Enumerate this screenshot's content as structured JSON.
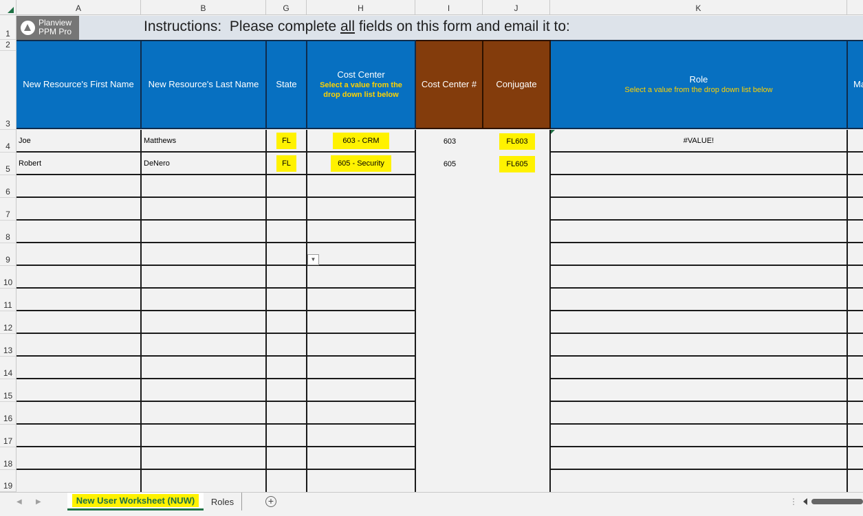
{
  "columns": [
    "A",
    "B",
    "G",
    "H",
    "I",
    "J",
    "K"
  ],
  "rows": [
    "1",
    "2",
    "3",
    "4",
    "5",
    "6",
    "7",
    "8",
    "9",
    "10",
    "11",
    "12",
    "13",
    "14",
    "15",
    "16",
    "17",
    "18",
    "19"
  ],
  "logo": {
    "line1": "Planview",
    "line2": "PPM Pro"
  },
  "instructions": {
    "label": "Instructions:",
    "text_before": "Please complete",
    "underlined": "all",
    "text_after": "fields on this form and email it to:"
  },
  "headers": {
    "first_name": "New Resource's First Name",
    "last_name": "New Resource's Last Name",
    "state": "State",
    "cost_center": {
      "title": "Cost Center",
      "hint": "Select a value from the drop down list below"
    },
    "cost_center_num": "Cost Center #",
    "conjugate": "Conjugate",
    "role": {
      "title": "Role",
      "hint": "Select a value from the drop down list below"
    },
    "next_col_partial": "Ma"
  },
  "data_rows": [
    {
      "first": "Joe",
      "last": "Matthews",
      "state": "FL",
      "cost_center": "603 - CRM",
      "cc_num": "603",
      "conjugate": "FL603",
      "role": "#VALUE!"
    },
    {
      "first": "Robert",
      "last": "DeNero",
      "state": "FL",
      "cost_center": "605 - Security",
      "cc_num": "605",
      "conjugate": "FL605",
      "role": ""
    }
  ],
  "dropdown_icon": "chevron-down-icon",
  "sheet_tabs": {
    "active": "New User Worksheet (NUW)",
    "other": "Roles",
    "add": "+"
  },
  "colors": {
    "header_blue": "#0770c1",
    "header_brown": "#833c0c",
    "highlight": "#fff200",
    "hint_yellow": "#ffd200",
    "excel_green": "#1e7145"
  }
}
